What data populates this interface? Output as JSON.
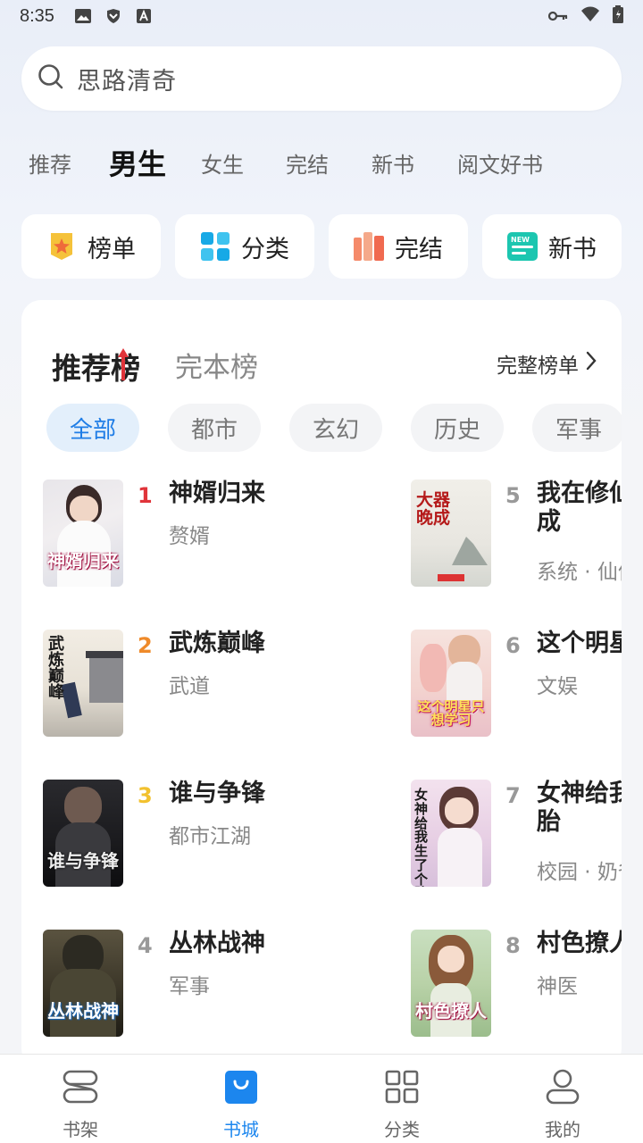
{
  "status_bar": {
    "time": "8:35"
  },
  "search": {
    "placeholder": "思路清奇"
  },
  "tabs": [
    {
      "label": "推荐",
      "active": false
    },
    {
      "label": "男生",
      "active": true
    },
    {
      "label": "女生",
      "active": false
    },
    {
      "label": "完结",
      "active": false
    },
    {
      "label": "新书",
      "active": false
    },
    {
      "label": "阅文好书",
      "active": false
    }
  ],
  "quick_links": [
    {
      "label": "榜单",
      "icon": "ranking-star-icon"
    },
    {
      "label": "分类",
      "icon": "category-grid-icon"
    },
    {
      "label": "完结",
      "icon": "completed-books-icon"
    },
    {
      "label": "新书",
      "icon": "new-book-icon"
    }
  ],
  "ranking": {
    "tabs": [
      {
        "label": "推荐榜",
        "active": true
      },
      {
        "label": "完本榜",
        "active": false
      }
    ],
    "more_label": "完整榜单",
    "filters": [
      {
        "label": "全部",
        "active": true
      },
      {
        "label": "都市",
        "active": false
      },
      {
        "label": "玄幻",
        "active": false
      },
      {
        "label": "历史",
        "active": false
      },
      {
        "label": "军事",
        "active": false
      }
    ],
    "books": [
      {
        "rank": "1",
        "title": "神婿归来",
        "tag": "赘婿",
        "cover_text": "神婿归来",
        "rank_color": "#e0343a"
      },
      {
        "rank": "2",
        "title": "武炼巅峰",
        "tag": "武道",
        "cover_text": "武炼巅峰",
        "rank_color": "#ef8a2a"
      },
      {
        "rank": "3",
        "title": "谁与争锋",
        "tag": "都市江湖",
        "cover_text": "谁与争锋",
        "rank_color": "#f2c12e"
      },
      {
        "rank": "4",
        "title": "丛林战神",
        "tag": "军事",
        "cover_text": "丛林战神",
        "rank_color": "#999999"
      },
      {
        "rank": "5",
        "title": "我在修仙",
        "title_line2": "成",
        "tag": "系统 · 仙侠",
        "cover_text": "大器晚成",
        "rank_color": "#999999"
      },
      {
        "rank": "6",
        "title": "这个明星",
        "tag": "文娱",
        "cover_text": "这个明星只想学习",
        "rank_color": "#999999"
      },
      {
        "rank": "7",
        "title": "女神给我",
        "title_line2": "胎",
        "tag": "校园 · 奶爸",
        "cover_text": "女神给我生了个胎",
        "rank_color": "#999999"
      },
      {
        "rank": "8",
        "title": "村色撩人",
        "tag": "神医",
        "cover_text": "村色撩人",
        "rank_color": "#999999"
      }
    ]
  },
  "bottom_nav": [
    {
      "label": "书架",
      "icon": "bookshelf-icon",
      "active": false
    },
    {
      "label": "书城",
      "icon": "bookstore-bag-icon",
      "active": true
    },
    {
      "label": "分类",
      "icon": "category-grid-icon",
      "active": false
    },
    {
      "label": "我的",
      "icon": "profile-icon",
      "active": false
    }
  ]
}
